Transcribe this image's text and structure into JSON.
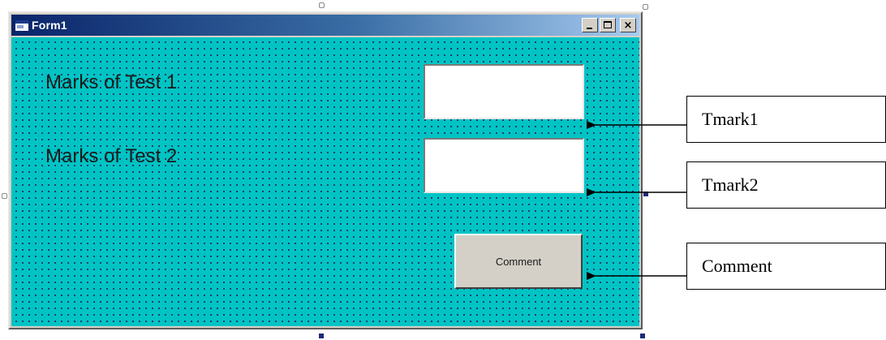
{
  "form": {
    "title": "Form1",
    "controls": {
      "minimize_glyph": "minimize-icon",
      "maximize_glyph": "maximize-icon",
      "close_glyph": "×"
    },
    "background_color": "#00c4c4",
    "label1": "Marks of Test 1",
    "label2": "Marks of Test 2",
    "text1_value": "",
    "text2_value": "",
    "button_label": "Comment"
  },
  "annotations": [
    {
      "text": "Tmark1",
      "target": "text1"
    },
    {
      "text": "Tmark2",
      "target": "text2"
    },
    {
      "text": "Comment",
      "target": "comment-button"
    }
  ]
}
